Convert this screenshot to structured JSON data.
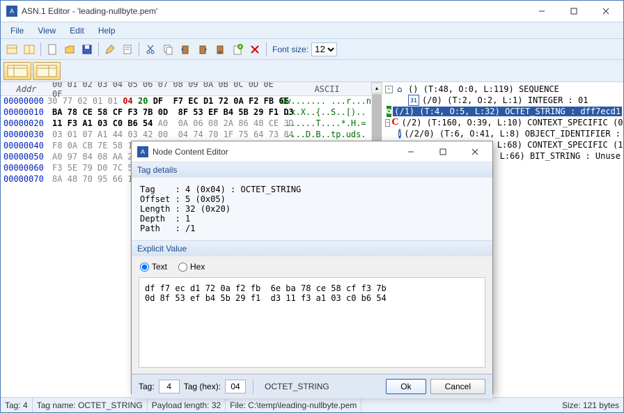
{
  "window": {
    "title": "ASN.1 Editor - 'leading-nullbyte.pem'"
  },
  "menu": {
    "file": "File",
    "view": "View",
    "edit": "Edit",
    "help": "Help"
  },
  "toolbar": {
    "font_size_label": "Font size:",
    "font_size_value": "12"
  },
  "hex": {
    "addr_header": "Addr",
    "byte_header": "00 01 02 03 04 05 06 07  08 09 0A 0B 0C 0D 0E 0F",
    "ascii_header": "ASCII",
    "rows": [
      {
        "addr": "00000000",
        "bytes_pre": "30 77 02 01 01 ",
        "bytes_red": "04 ",
        "bytes_grn": "20 ",
        "bytes_data": "DF  F7 EC D1 72 0A F2 FB 6E",
        "ascii": "0w....... ...r...n"
      },
      {
        "addr": "00000010",
        "bytes_pre": "",
        "bytes_red": "",
        "bytes_grn": "",
        "bytes_data": "BA 78 CE 58 CF F3 7B 0D  8F 53 EF B4 5B 29 F1 D3",
        "ascii": ".x.X..{..S..[).."
      },
      {
        "addr": "00000020",
        "bytes_pre": "",
        "bytes_red": "",
        "bytes_grn": "",
        "bytes_data": "11 F3 A1 03 C0 B6 54 ",
        "bytes_post": "A0  0A 06 08 2A 86 48 CE 3D",
        "ascii": "......T....*.H.="
      },
      {
        "addr": "00000030",
        "bytes_pre": "03 01 07 A1 44 03 42 00  04 74 70 1F 75 64 73 84",
        "ascii": "....D.B..tp.uds."
      },
      {
        "addr": "00000040",
        "bytes_pre": "F8 0A CB 7E 58 13 8B ",
        "ascii": ""
      },
      {
        "addr": "00000050",
        "bytes_pre": "A0 97 84 08 AA 2C 2",
        "ascii": ""
      },
      {
        "addr": "00000060",
        "bytes_pre": "F3 5E 79 D0 7C 57 A",
        "ascii": ""
      },
      {
        "addr": "00000070",
        "bytes_pre": "8A 48 70 95 66 14 9",
        "ascii": ""
      }
    ]
  },
  "tree": {
    "items": [
      {
        "indent": 0,
        "exp": "-",
        "icon": "home",
        "label": "() (T:48, O:0, L:119) SEQUENCE",
        "sel": false
      },
      {
        "indent": 1,
        "exp": "",
        "icon": "n31",
        "label": "(/0) (T:2, O:2, L:1) INTEGER : 01",
        "sel": false
      },
      {
        "indent": 1,
        "exp": "",
        "icon": "greenblk",
        "label": "(/1) (T:4, O:5, L:32) OCTET_STRING : dff7ecd1",
        "sel": true
      },
      {
        "indent": 1,
        "exp": "-",
        "icon": "redc",
        "label": "(/2) (T:160, O:39, L:10) CONTEXT_SPECIFIC (0)",
        "sel": false
      },
      {
        "indent": 2,
        "exp": "",
        "icon": "info",
        "label": "(/2/0) (T:6, O:41, L:8) OBJECT_IDENTIFIER :",
        "sel": false
      },
      {
        "indent": 1,
        "exp": "-",
        "icon": "redc",
        "label": "(/3) (T:161, O:51, L:68) CONTEXT_SPECIFIC (1)",
        "sel": false
      },
      {
        "indent": 2,
        "exp": "",
        "icon": "bars",
        "label": "(/3/0) (T:3, O:53, L:66) BIT_STRING : Unuse",
        "sel": false
      }
    ]
  },
  "dialog": {
    "title": "Node Content Editor",
    "tag_details_title": "Tag details",
    "tag_details_body": "Tag    : 4 (0x04) : OCTET_STRING\nOffset : 5 (0x05)\nLength : 32 (0x20)\nDepth  : 1\nPath   : /1",
    "explicit_value_title": "Explicit Value",
    "radio_text": "Text",
    "radio_hex": "Hex",
    "value_body": "df f7 ec d1 72 0a f2 fb  6e ba 78 ce 58 cf f3 7b\n0d 8f 53 ef b4 5b 29 f1  d3 11 f3 a1 03 c0 b6 54",
    "tag_label": "Tag:",
    "tag_value": "4",
    "tag_hex_label": "Tag (hex):",
    "tag_hex_value": "04",
    "tag_name": "OCTET_STRING",
    "ok": "Ok",
    "cancel": "Cancel"
  },
  "status": {
    "tag": "Tag: 4",
    "tag_name": "Tag name: OCTET_STRING",
    "payload": "Payload length: 32",
    "file": "File: C:\\temp\\leading-nullbyte.pem",
    "size": "Size: 121 bytes"
  }
}
